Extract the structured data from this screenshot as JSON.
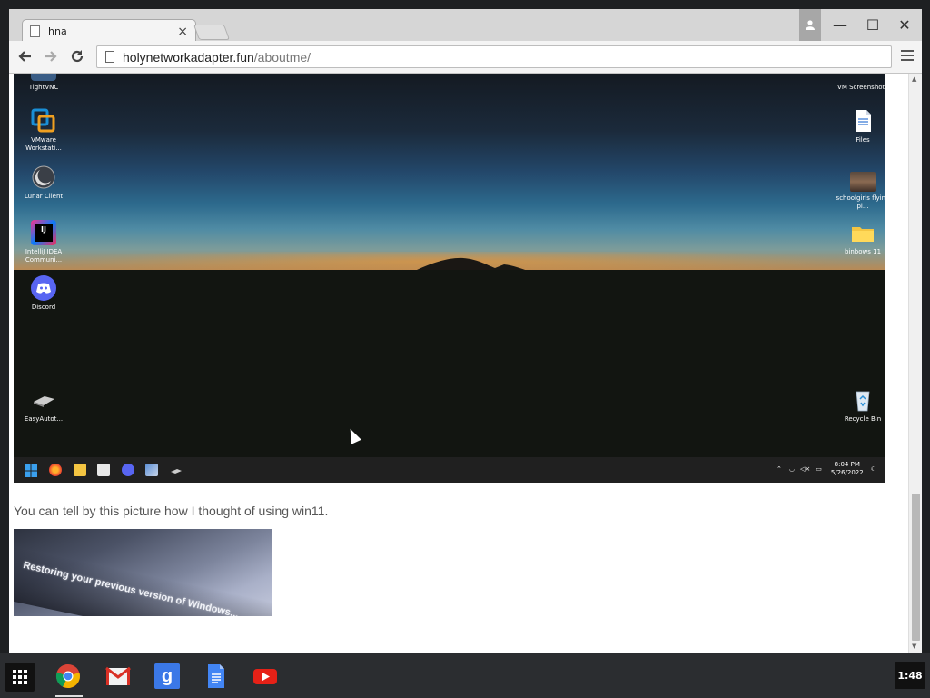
{
  "browser": {
    "tab_title": "hna",
    "tab_close": "×",
    "url_host": "holynetworkadapter.fun",
    "url_path": "/aboutme/",
    "window_controls": {
      "minimize": "—",
      "maximize": "☐",
      "close": "✕"
    }
  },
  "page": {
    "screenshot": {
      "left_icons": [
        {
          "label": "TightVNC",
          "icon": "tightvnc-icon"
        },
        {
          "label": "VMware Workstati...",
          "icon": "vmware-icon"
        },
        {
          "label": "Lunar Client",
          "icon": "lunar-client-icon"
        },
        {
          "label": "IntelliJ IDEA Communi...",
          "icon": "intellij-icon"
        },
        {
          "label": "Discord",
          "icon": "discord-icon"
        },
        {
          "label": "EasyAutot...",
          "icon": "easyautot-icon"
        }
      ],
      "right_icons": [
        {
          "label": "VM Screenshots",
          "icon": "folder-icon"
        },
        {
          "label": "Files",
          "icon": "file-icon"
        },
        {
          "label": "schoolgirls flying pl...",
          "icon": "image-thumbnail-icon"
        },
        {
          "label": "binbows 11",
          "icon": "folder-icon"
        },
        {
          "label": "Recycle Bin",
          "icon": "recycle-bin-icon"
        }
      ],
      "taskbar": {
        "time": "8:04 PM",
        "date": "5/26/2022"
      }
    },
    "caption": "You can tell by this picture how I thought of using win11.",
    "photo_text": "Restoring your previous version of Windows..."
  },
  "shelf": {
    "apps": [
      "chrome-icon",
      "gmail-icon",
      "google-search-icon",
      "google-docs-icon",
      "youtube-icon"
    ],
    "clock": "1:48"
  }
}
